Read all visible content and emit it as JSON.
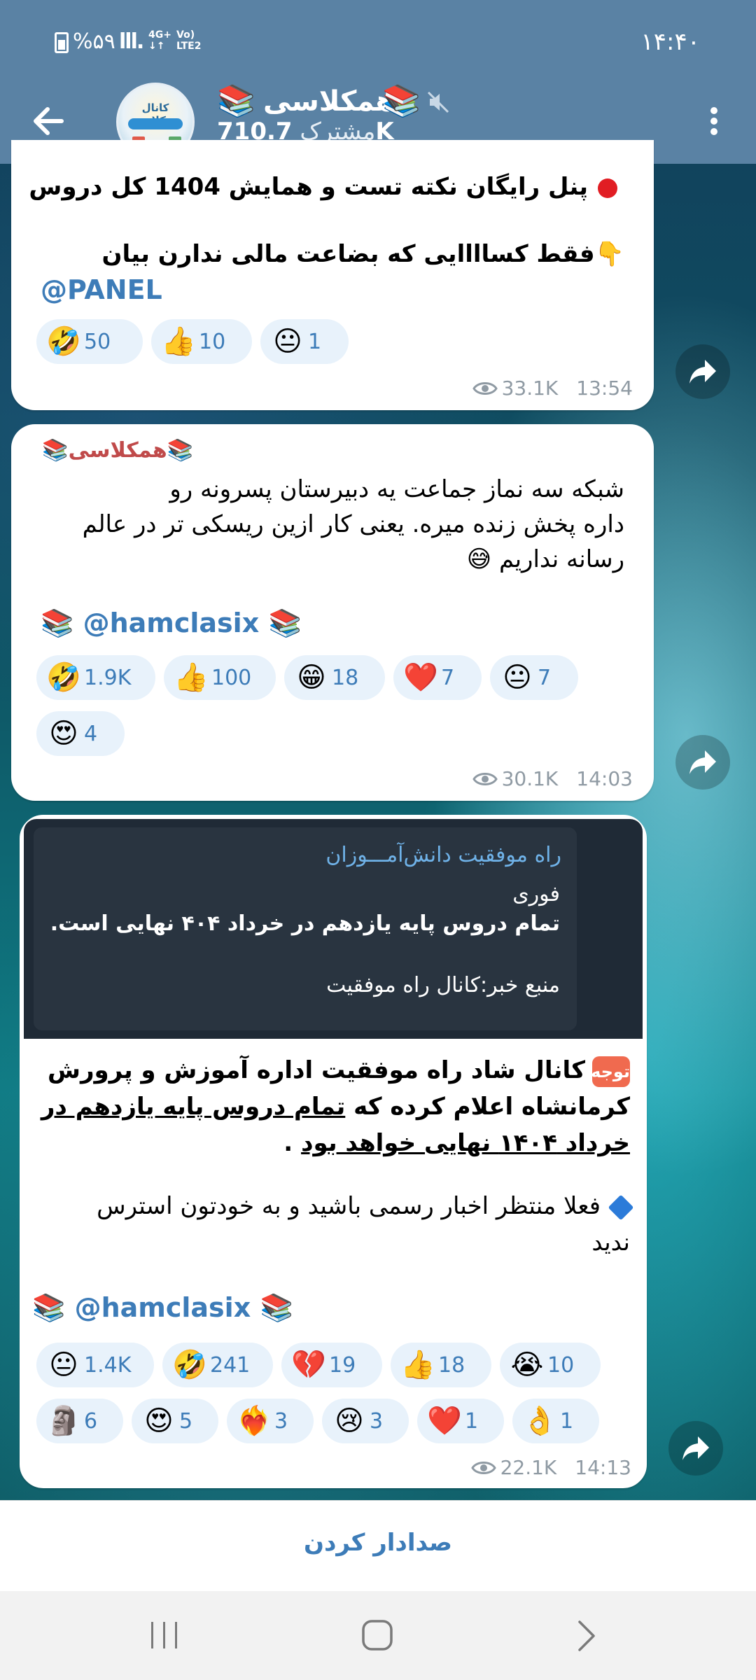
{
  "status_bar": {
    "time": "۱۴:۴۰",
    "battery": "%۵۹",
    "signal": "lll.",
    "network_top": "4G+",
    "network_bottom": "↓↑",
    "volte_top": "Vo)",
    "volte_bottom": "LTE2"
  },
  "header": {
    "channel_name": "همکلاسی",
    "subscriber_count": "710.7K",
    "subscriber_label": "مشترک",
    "avatar_title": "کانال همکلاسی",
    "icons": [
      "back-arrow-icon",
      "books-icon",
      "mute-icon",
      "more-vertical-icon"
    ]
  },
  "messages": [
    {
      "line1_bold": "پنل رایگان نکته تست و همایش 1404 کل دروس",
      "line2_bold": "فقط کساااایی که بضاعت مالی ندارن بیان",
      "line2_emoji": "👇",
      "link": "@PANEL",
      "reactions": [
        {
          "emoji": "🤣",
          "count": "50"
        },
        {
          "emoji": "👍",
          "count": "10"
        },
        {
          "emoji": "😐",
          "count": "1"
        }
      ],
      "views": "33.1K",
      "time": "13:54"
    },
    {
      "author": "همکلاسی",
      "line1": "شبکه سه نماز جماعت یه دبیرستان پسرونه رو",
      "line2": "داره پخش زنده میره. یعنی کار ازین ریسکی تر در عالم",
      "line3": "رسانه نداریم",
      "line3_emoji": "😅",
      "link": "@hamclasix",
      "reactions": [
        {
          "emoji": "🤣",
          "count": "1.9K"
        },
        {
          "emoji": "👍",
          "count": "100"
        },
        {
          "emoji": "😁",
          "count": "18"
        },
        {
          "emoji": "❤️",
          "count": "7"
        },
        {
          "emoji": "😐",
          "count": "7"
        },
        {
          "emoji": "😍",
          "count": "4"
        }
      ],
      "views": "30.1K",
      "time": "14:03"
    },
    {
      "quote_title": "راه موفقیت دانش‌آمـــوزان",
      "quote_line1": "فوری",
      "quote_line2": "تمام دروس پایه یازدهم در خرداد ۴۰۴ نهایی است.",
      "quote_line3": "منبع خبر:کانال راه موفقیت",
      "badge": "توجه",
      "p1_line1": "کانال شاد راه موفقیت اداره آموزش و پرورش",
      "p1_line2_plain": "کرمانشاه اعلام کرده که",
      "p1_line2_underline": "تمام دروس پایه یازدهم در",
      "p1_line3_underline": "خرداد ۱۴۰۴ نهایی خواهد بود",
      "p1_line3_end": " .",
      "p2_line1": "فعلا منتظر اخبار رسمی باشید و به خودتون استرس",
      "p2_line2": "ندید",
      "link": "@hamclasix",
      "reactions_row1": [
        {
          "emoji": "😐",
          "count": "1.4K"
        },
        {
          "emoji": "🤣",
          "count": "241"
        },
        {
          "emoji": "💔",
          "count": "19"
        },
        {
          "emoji": "👍",
          "count": "18"
        },
        {
          "emoji": "😭",
          "count": "10"
        }
      ],
      "reactions_row2": [
        {
          "emoji": "🗿",
          "count": "6"
        },
        {
          "emoji": "😍",
          "count": "5"
        },
        {
          "emoji": "❤️‍🔥",
          "count": "3"
        },
        {
          "emoji": "😢",
          "count": "3"
        },
        {
          "emoji": "❤️",
          "count": "1"
        },
        {
          "emoji": "👌",
          "count": "1"
        }
      ],
      "views": "22.1K",
      "time": "14:13"
    }
  ],
  "books_emoji": "📚",
  "bottom": {
    "unmute_label": "صدادار کردن"
  },
  "colors": {
    "header": "#5a82a4",
    "link": "#3d7cb8",
    "reaction_bg": "#e8f2fb",
    "author": "#c04a4a"
  }
}
